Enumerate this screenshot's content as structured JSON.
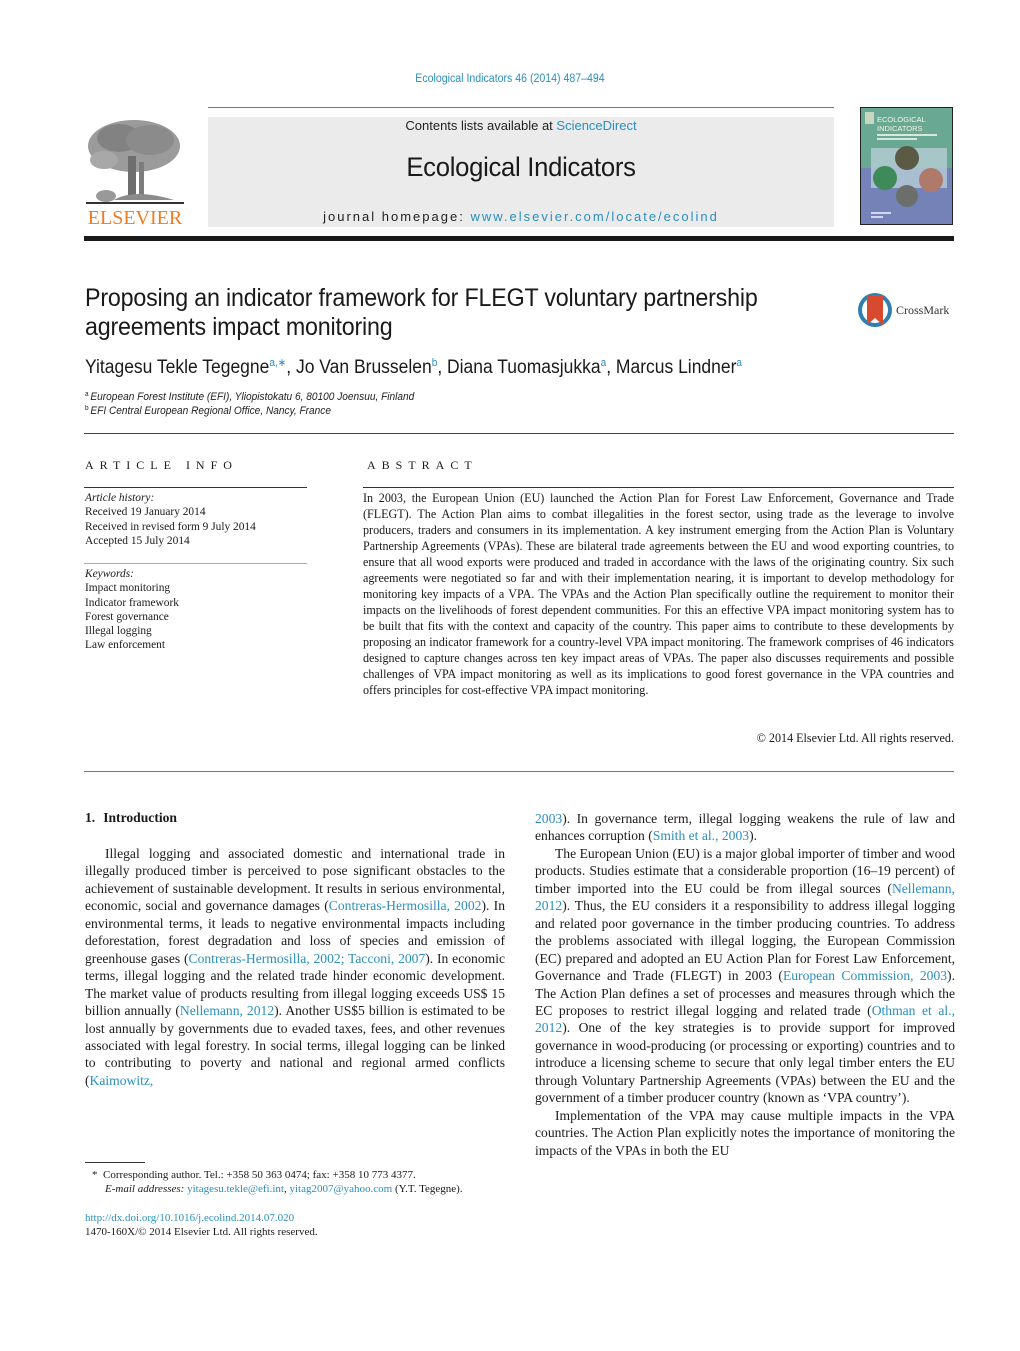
{
  "citation": "Ecological Indicators 46 (2014) 487–494",
  "header": {
    "publisher_logo_text": "ELSEVIER",
    "contents_prefix": "Contents lists available at ",
    "contents_link": "ScienceDirect",
    "journal_title": "Ecological Indicators",
    "homepage_prefix": "journal homepage: ",
    "homepage_link": "www.elsevier.com/locate/ecolind",
    "cover_title_line1": "ECOLOGICAL",
    "cover_title_line2": "INDICATORS"
  },
  "article": {
    "title": "Proposing an indicator framework for FLEGT voluntary partnership agreements impact monitoring",
    "crossmark_label": "CrossMark",
    "authors": [
      {
        "name": "Yitagesu Tekle Tegegne",
        "sup": "a,∗"
      },
      {
        "name": "Jo Van Brusselen",
        "sup": "b"
      },
      {
        "name": "Diana Tuomasjukka",
        "sup": "a"
      },
      {
        "name": "Marcus Lindner",
        "sup": "a"
      }
    ],
    "affiliations": [
      {
        "mark": "a",
        "text": "European Forest Institute (EFI), Yliopistokatu 6, 80100 Joensuu, Finland"
      },
      {
        "mark": "b",
        "text": "EFI Central European Regional Office, Nancy, France"
      }
    ]
  },
  "article_info": {
    "heading": "ARTICLE INFO",
    "history_label": "Article history:",
    "history": [
      "Received 19 January 2014",
      "Received in revised form 9 July 2014",
      "Accepted 15 July 2014"
    ],
    "keywords_label": "Keywords:",
    "keywords": [
      "Impact monitoring",
      "Indicator framework",
      "Forest governance",
      "Illegal logging",
      "Law enforcement"
    ]
  },
  "abstract": {
    "heading": "ABSTRACT",
    "text": "In 2003, the European Union (EU) launched the Action Plan for Forest Law Enforcement, Governance and Trade (FLEGT). The Action Plan aims to combat illegalities in the forest sector, using trade as the leverage to involve producers, traders and consumers in its implementation. A key instrument emerging from the Action Plan is Voluntary Partnership Agreements (VPAs). These are bilateral trade agreements between the EU and wood exporting countries, to ensure that all wood exports were produced and traded in accordance with the laws of the originating country. Six such agreements were negotiated so far and with their implementation nearing, it is important to develop methodology for monitoring key impacts of a VPA. The VPAs and the Action Plan specifically outline the requirement to monitor their impacts on the livelihoods of forest dependent communities. For this an effective VPA impact monitoring system has to be built that fits with the context and capacity of the country. This paper aims to contribute to these developments by proposing an indicator framework for a country-level VPA impact monitoring. The framework comprises of 46 indicators designed to capture changes across ten key impact areas of VPAs. The paper also discusses requirements and possible challenges of VPA impact monitoring as well as its implications to good forest governance in the VPA countries and offers principles for cost-effective VPA impact monitoring.",
    "copyright": "© 2014 Elsevier Ltd. All rights reserved."
  },
  "body": {
    "section_number": "1.",
    "section_title": "Introduction",
    "left_paragraph": {
      "t1": "Illegal logging and associated domestic and international trade in illegally produced timber is perceived to pose significant obstacles to the achievement of sustainable development. It results in serious environmental, economic, social and governance damages (",
      "c1": "Contreras-Hermosilla, 2002",
      "t2": "). In environmental terms, it leads to negative environmental impacts including deforestation, forest degradation and loss of species and emission of greenhouse gases (",
      "c2": "Contreras-Hermosilla, 2002; Tacconi, 2007",
      "t3": "). In economic terms, illegal logging and the related trade hinder economic development. The market value of products resulting from illegal logging exceeds US$ 15 billion annually (",
      "c3": "Nellemann, 2012",
      "t4": "). Another US$5 billion is estimated to be lost annually by governments due to evaded taxes, fees, and other revenues associated with legal forestry. In social terms, illegal logging can be linked to contributing to poverty and national and regional armed conflicts (",
      "c4": "Kaimowitz,"
    },
    "right_paragraph_1": {
      "c1": "2003",
      "t1": "). In governance term, illegal logging weakens the rule of law and enhances corruption (",
      "c2": "Smith et al., 2003",
      "t2": ")."
    },
    "right_paragraph_2": {
      "t1": "The European Union (EU) is a major global importer of timber and wood products. Studies estimate that a considerable proportion (16–19 percent) of timber imported into the EU could be from illegal sources (",
      "c1": "Nellemann, 2012",
      "t2": "). Thus, the EU considers it a responsibility to address illegal logging and related poor governance in the timber producing countries. To address the problems associated with illegal logging, the European Commission (EC) prepared and adopted an EU Action Plan for Forest Law Enforcement, Governance and Trade (FLEGT) in 2003 (",
      "c2": "European Commission, 2003",
      "t3": "). The Action Plan defines a set of processes and measures through which the EC proposes to restrict illegal logging and related trade (",
      "c3": "Othman et al., 2012",
      "t4": "). One of the key strategies is to provide support for improved governance in wood-producing (or processing or exporting) countries and to introduce a licensing scheme to secure that only legal timber enters the EU through Voluntary Partnership Agreements (VPAs) between the EU and the government of a timber producer country (known as ‘VPA country’)."
    },
    "right_paragraph_3": {
      "t1": "Implementation of the VPA may cause multiple impacts in the VPA countries. The Action Plan explicitly notes the importance of monitoring the impacts of the VPAs in both the EU"
    }
  },
  "footnotes": {
    "corresponding_mark": "*",
    "corresponding": "Corresponding author. Tel.: +358 50 363 0474; fax: +358 10 773 4377.",
    "email_label": "E-mail addresses:",
    "email1": "yitagesu.tekle@efi.int",
    "email2": "yitag2007@yahoo.com",
    "email_suffix": " (Y.T. Tegegne).",
    "doi": "http://dx.doi.org/10.1016/j.ecolind.2014.07.020",
    "issn": "1470-160X/© 2014 Elsevier Ltd. All rights reserved."
  },
  "colors": {
    "link": "#2a8fbd",
    "elsevier_orange": "#f07b21",
    "header_grey": "#ebebeb",
    "crossmark_red": "#d84a2f",
    "crossmark_ring": "#2f7fb0"
  }
}
